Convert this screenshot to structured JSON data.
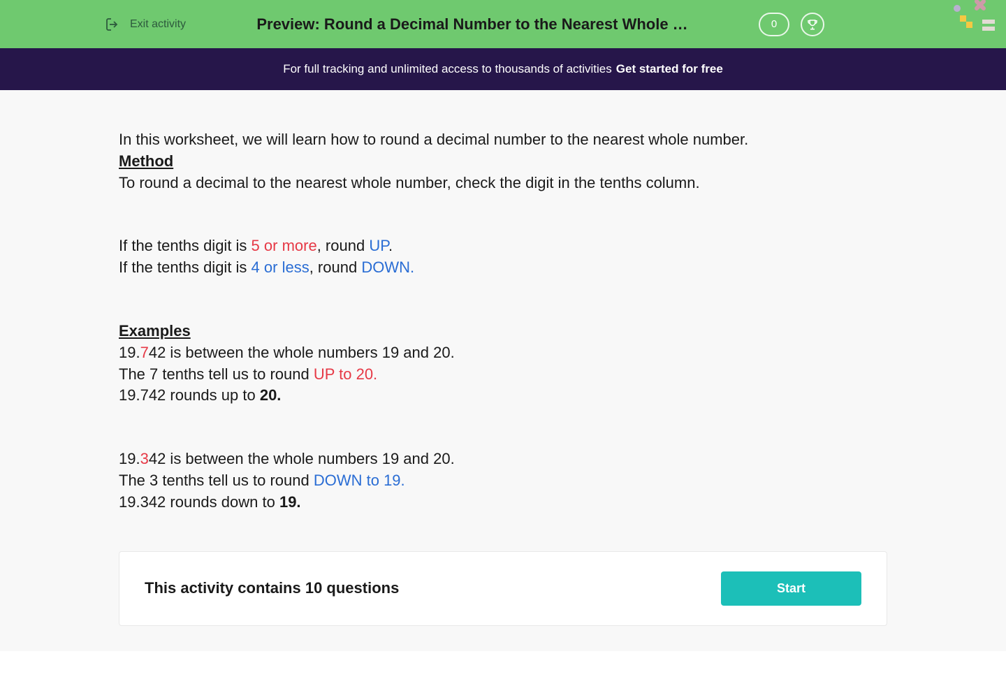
{
  "header": {
    "exit_label": "Exit activity",
    "title": "Preview: Round a Decimal Number to the Nearest Whole …",
    "score": "0"
  },
  "banner": {
    "text": "For full tracking and unlimited access to thousands of activities",
    "cta": "Get started for free"
  },
  "content": {
    "intro": "In this worksheet, we will learn how to round a decimal number to the nearest whole number.",
    "method_title": "Method",
    "method_line1": "To round a decimal to the nearest whole number, check the digit in the tenths column.",
    "rule1_prefix": "If the tenths digit is ",
    "rule1_red": "5 or more",
    "rule1_mid": ", round ",
    "rule1_blue": "UP",
    "rule1_suffix": ".",
    "rule2_prefix": "If the tenths digit is ",
    "rule2_blue1": "4 or less",
    "rule2_mid": ", round ",
    "rule2_blue2": "DOWN.",
    "examples_title": "Examples",
    "ex1_l1_a": "19.",
    "ex1_l1_red": "7",
    "ex1_l1_b": "42 is between the whole numbers 19 and 20.",
    "ex1_l2_a": "The 7 tenths tell us to round ",
    "ex1_l2_red": "UP to 20.",
    "ex1_l3_a": "19.742 rounds up to ",
    "ex1_l3_bold": "20.",
    "ex2_l1_a": "19.",
    "ex2_l1_red": "3",
    "ex2_l1_b": "42 is between the whole numbers 19 and 20.",
    "ex2_l2_a": "The 3 tenths tell us to round ",
    "ex2_l2_blue": "DOWN to 19.",
    "ex2_l3_a": "19.342 rounds down to ",
    "ex2_l3_bold": "19."
  },
  "footer": {
    "question_count": "This activity contains 10 questions",
    "start_label": "Start"
  },
  "colors": {
    "header_bg": "#6fc96f",
    "banner_bg": "#26164a",
    "red": "#e63946",
    "blue": "#2a6dd4",
    "start_btn": "#1cbfb8"
  }
}
